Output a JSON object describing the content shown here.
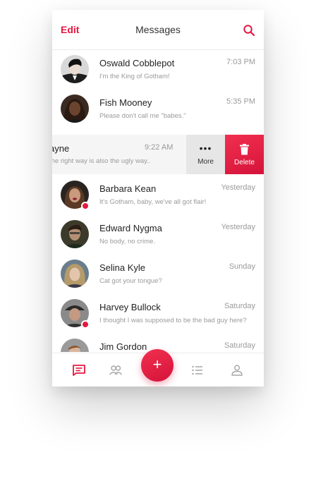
{
  "header": {
    "edit_label": "Edit",
    "title": "Messages"
  },
  "conversations": [
    {
      "name": "Oswald Cobblepot",
      "preview": "I'm the King of Gotham!",
      "time": "7:03 PM",
      "unread": false
    },
    {
      "name": "Fish Mooney",
      "preview": "Please don't call me \"babes.\"",
      "time": "5:35 PM",
      "unread": false
    },
    {
      "name": "Barbara Kean",
      "preview": "It's Gotham, baby, we've all got flair!",
      "time": "Yesterday",
      "unread": true
    },
    {
      "name": "Edward Nygma",
      "preview": "No body, no crime.",
      "time": "Yesterday",
      "unread": false
    },
    {
      "name": "Selina Kyle",
      "preview": "Cat got your tongue?",
      "time": "Sunday",
      "unread": false
    },
    {
      "name": "Harvey Bullock",
      "preview": "I thought I was supposed to be the bad guy here?",
      "time": "Saturday",
      "unread": true
    },
    {
      "name": "Jim Gordon",
      "preview": "",
      "time": "Saturday",
      "unread": false
    }
  ],
  "swiped": {
    "name": "ayne",
    "preview": "the right way is also the ugly way..",
    "time": "9:22 AM"
  },
  "actions": {
    "more_label": "More",
    "delete_label": "Delete"
  },
  "fab": {
    "label": "+"
  },
  "colors": {
    "accent": "#e5173f",
    "accent_dark": "#d5133a"
  },
  "icons": {
    "tab_messages": "chat-icon",
    "tab_contacts": "contacts-icon",
    "tab_list": "list-icon",
    "tab_profile": "profile-icon",
    "search": "search-icon",
    "delete": "trash-icon",
    "more": "more-dots-icon"
  }
}
